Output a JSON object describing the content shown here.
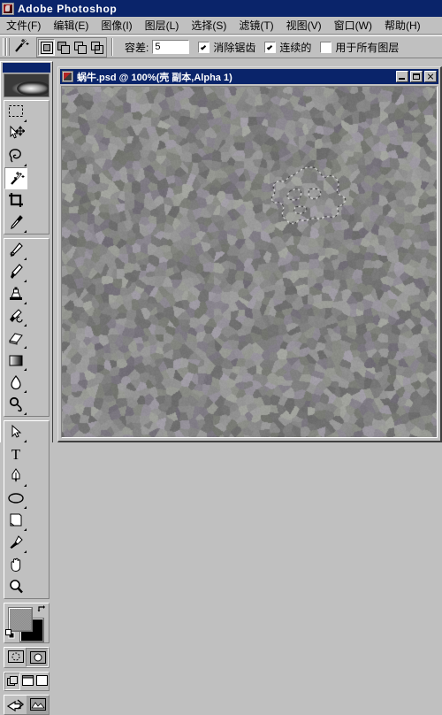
{
  "app": {
    "title": "Adobe Photoshop",
    "icon": "photoshop-icon"
  },
  "menubar": {
    "items": [
      {
        "label": "文件(F)"
      },
      {
        "label": "编辑(E)"
      },
      {
        "label": "图像(I)"
      },
      {
        "label": "图层(L)"
      },
      {
        "label": "选择(S)"
      },
      {
        "label": "滤镜(T)"
      },
      {
        "label": "视图(V)"
      },
      {
        "label": "窗口(W)"
      },
      {
        "label": "帮助(H)"
      }
    ]
  },
  "options_bar": {
    "active_tool_icon": "magic-wand-icon",
    "selection_modes": [
      {
        "name": "new-selection",
        "active": true
      },
      {
        "name": "add-to-selection",
        "active": false
      },
      {
        "name": "subtract-from-selection",
        "active": false
      },
      {
        "name": "intersect-selection",
        "active": false
      }
    ],
    "tolerance_label": "容差:",
    "tolerance_value": "5",
    "anti_alias_label": "消除锯齿",
    "anti_alias_checked": true,
    "contiguous_label": "连续的",
    "contiguous_checked": true,
    "all_layers_label": "用于所有图层",
    "all_layers_checked": false
  },
  "toolbox": {
    "banner_icon": "photoshop-eye-banner",
    "tools": [
      {
        "name": "marquee-tool",
        "icon": "rectangular-marquee-icon",
        "selected": false
      },
      {
        "name": "move-tool",
        "icon": "move-arrow-icon",
        "selected": false
      },
      {
        "name": "lasso-tool",
        "icon": "lasso-icon",
        "selected": false
      },
      {
        "name": "magic-wand-tool",
        "icon": "magic-wand-icon",
        "selected": true
      },
      {
        "name": "crop-tool",
        "icon": "crop-icon",
        "selected": false
      },
      {
        "name": "slice-tool",
        "icon": "slice-knife-icon",
        "selected": false
      },
      {
        "name": "healing-brush-tool",
        "icon": "healing-brush-icon",
        "selected": false
      },
      {
        "name": "brush-tool",
        "icon": "paintbrush-icon",
        "selected": false
      },
      {
        "name": "clone-stamp-tool",
        "icon": "clone-stamp-icon",
        "selected": false
      },
      {
        "name": "history-brush-tool",
        "icon": "history-brush-icon",
        "selected": false
      },
      {
        "name": "eraser-tool",
        "icon": "eraser-icon",
        "selected": false
      },
      {
        "name": "gradient-tool",
        "icon": "gradient-icon",
        "selected": false
      },
      {
        "name": "blur-tool",
        "icon": "water-drop-icon",
        "selected": false
      },
      {
        "name": "dodge-tool",
        "icon": "dodge-icon",
        "selected": false
      },
      {
        "name": "path-selection-tool",
        "icon": "path-arrow-icon",
        "selected": false
      },
      {
        "name": "type-tool",
        "icon": "text-T-icon",
        "selected": false
      },
      {
        "name": "pen-tool",
        "icon": "pen-nib-icon",
        "selected": false
      },
      {
        "name": "shape-tool",
        "icon": "ellipse-shape-icon",
        "selected": false
      },
      {
        "name": "notes-tool",
        "icon": "notes-page-icon",
        "selected": false
      },
      {
        "name": "eyedropper-tool",
        "icon": "eyedropper-icon",
        "selected": false
      },
      {
        "name": "hand-tool",
        "icon": "hand-icon",
        "selected": false
      },
      {
        "name": "zoom-tool",
        "icon": "magnifier-icon",
        "selected": false
      }
    ],
    "colors": {
      "foreground": "#969696",
      "background": "#000000",
      "swap_icon": "swap-colors-icon",
      "default_icon": "default-colors-icon"
    },
    "mask_modes": [
      {
        "name": "standard-mask-mode",
        "icon": "standard-mode-icon",
        "active": false
      },
      {
        "name": "quick-mask-mode",
        "icon": "quick-mask-icon",
        "active": true
      }
    ],
    "screen_modes": [
      {
        "name": "standard-screen-mode",
        "icon": "standard-screen-icon",
        "active": true
      },
      {
        "name": "full-screen-menubar-mode",
        "icon": "full-screen-menu-icon",
        "active": false
      },
      {
        "name": "full-screen-mode",
        "icon": "full-screen-icon",
        "active": false
      }
    ],
    "jump_buttons": [
      {
        "name": "jump-to-imageready",
        "icon": "jump-arrow-icon"
      },
      {
        "name": "imageready-preview",
        "icon": "imageready-icon"
      }
    ]
  },
  "document_window": {
    "icon": "document-icon",
    "title": "蜗牛.psd @ 100%(壳 副本,Alpha 1)",
    "buttons": [
      {
        "name": "minimize-button",
        "icon": "minimize-icon"
      },
      {
        "name": "maximize-button",
        "icon": "maximize-icon"
      },
      {
        "name": "close-button",
        "icon": "close-icon"
      }
    ],
    "zoom": "100%",
    "canvas": {
      "base_color": "#808080",
      "texture": "crystallize",
      "selection": {
        "name": "marching-ants-selection",
        "style": "dashed-black-white"
      }
    }
  }
}
